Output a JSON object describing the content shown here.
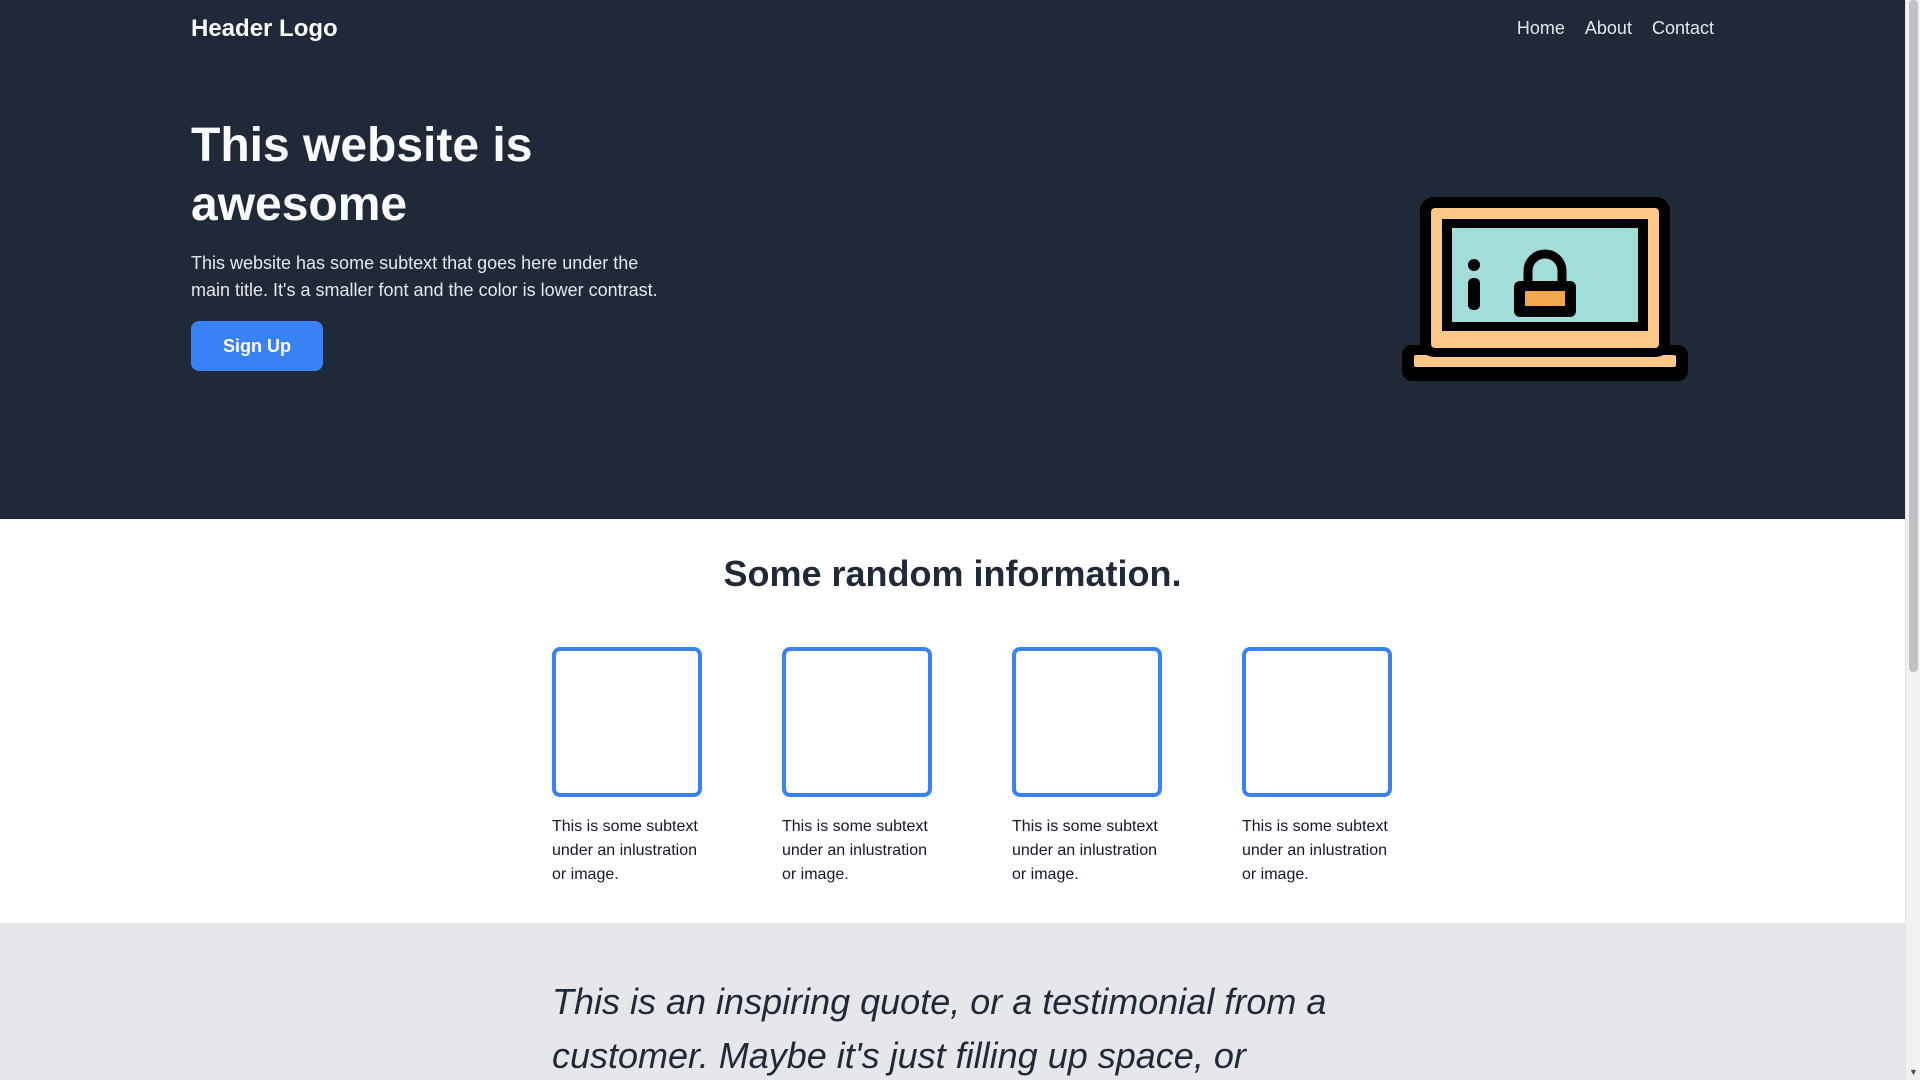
{
  "header": {
    "logo": "Header Logo",
    "nav": [
      {
        "label": "Home"
      },
      {
        "label": "About"
      },
      {
        "label": "Contact"
      }
    ]
  },
  "hero": {
    "title": "This website is awesome",
    "subtext": "This website has some subtext that goes here under the main title. It's a smaller font and the color is lower contrast.",
    "button_label": "Sign Up",
    "illustration": "laptop-lock-icon"
  },
  "info": {
    "title": "Some random information.",
    "cards": [
      {
        "text": "This is some subtext under an inlustration or image."
      },
      {
        "text": "This is some subtext under an inlustration or image."
      },
      {
        "text": "This is some subtext under an inlustration or image."
      },
      {
        "text": "This is some subtext under an inlustration or image."
      }
    ]
  },
  "quote": {
    "text": "This is an inspiring quote, or a testimonial from a customer. Maybe it's just filling up space, or"
  },
  "colors": {
    "hero_bg": "#1f2937",
    "accent": "#3882f6",
    "quote_bg": "#e5e7eb"
  }
}
